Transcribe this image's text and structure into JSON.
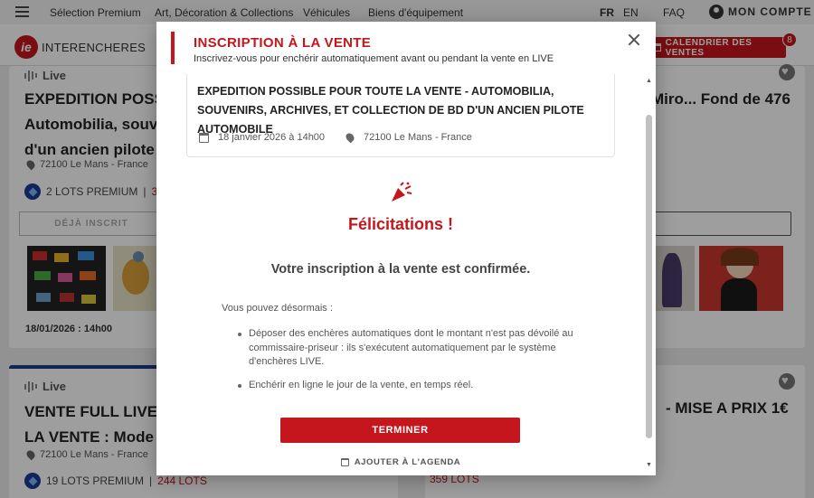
{
  "topnav": {
    "items": [
      "Sélection Premium",
      "Art, Décoration & Collections",
      "Véhicules",
      "Biens d'équipement"
    ],
    "lang_fr": "FR",
    "lang_en": "EN",
    "faq": "FAQ",
    "account": "MON COMPTE"
  },
  "brand": {
    "logo_mark": "ie",
    "logo_text": "INTERENCHERES",
    "calendar_label": "CALENDRIER DES VENTES",
    "calendar_badge": "8"
  },
  "cards": [
    {
      "live": "Live",
      "title_line1": "EXPEDITION POSSIBL",
      "title_line2": "Automobilia, souveni",
      "title_line3": "d'un ancien pilote aut",
      "location": "72100 Le Mans - France",
      "lots_premium": "2 LOTS PREMIUM",
      "lots_sep": "|",
      "lots_count": "36",
      "registered": "DÉJÀ INSCRIT",
      "date": "18/01/2026 : 14h00"
    },
    {
      "title_right": "Miro... Fond de 476"
    },
    {
      "live": "Live",
      "title_line1": "VENTE FULL LIVE - E",
      "title_line2": "LA VENTE : Mode Ma",
      "location": "72100 Le Mans - France",
      "lots_premium": "19 LOTS PREMIUM",
      "lots_sep": "|",
      "lots_count": "244 LOTS"
    },
    {
      "title_right": "- MISE A PRIX 1€",
      "lots_count": "359 LOTS"
    }
  ],
  "modal": {
    "title": "INSCRIPTION À LA VENTE",
    "subtitle": "Inscrivez-vous pour enchérir automatiquement avant ou pendant la vente en LIVE",
    "sale_title": "EXPEDITION POSSIBLE POUR TOUTE LA VENTE - AUTOMOBILIA, SOUVENIRS, ARCHIVES, ET COLLECTION DE BD D'UN ANCIEN PILOTE AUTOMOBILE",
    "sale_date": "18 janvier 2026 à 14h00",
    "sale_location": "72100 Le Mans - France",
    "congrats": "Félicitations !",
    "confirmed": "Votre inscription à la vente est confirmée.",
    "intro": "Vous pouvez désormais :",
    "bullets": [
      "Déposer des enchères automatiques dont le montant n'est pas dévoilé au commissaire-priseur : ils s'exécutent automatiquement par le système d'enchères LIVE.",
      "Enchérir en ligne le jour de la vente, en temps réel."
    ],
    "finish_label": "TERMINER",
    "agenda_label": "AJOUTER À L'AGENDA"
  },
  "colors": {
    "brand_red": "#c4161c",
    "premium_blue": "#1a3a8f"
  }
}
